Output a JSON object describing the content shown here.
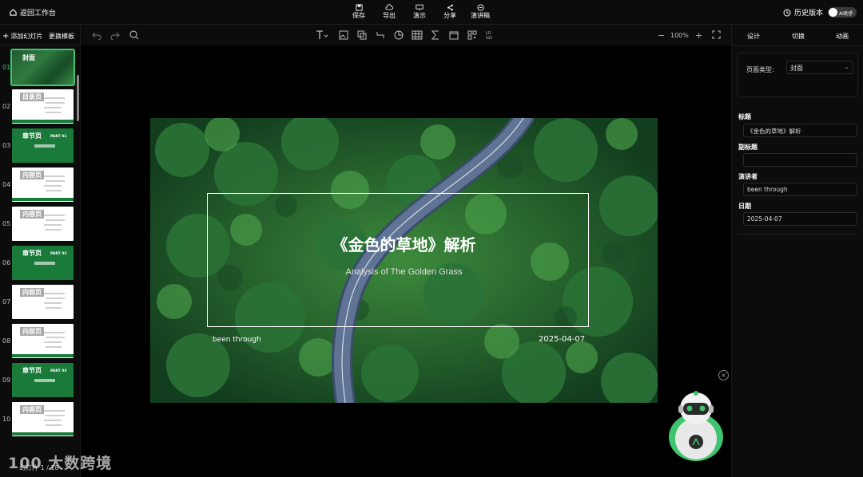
{
  "topbar": {
    "back_label": "返回工作台",
    "buttons": [
      {
        "label": "保存",
        "icon": "save-icon"
      },
      {
        "label": "导出",
        "icon": "cloud-upload-icon"
      },
      {
        "label": "演示",
        "icon": "present-icon"
      },
      {
        "label": "分享",
        "icon": "share-icon"
      },
      {
        "label": "演讲稿",
        "icon": "script-icon"
      }
    ],
    "history_label": "历史版本",
    "ai_toggle_label": "AI助手"
  },
  "sidebar": {
    "add_slide_label": "添加幻灯片",
    "change_template_label": "更换模板",
    "thumbnails": [
      {
        "num": "01",
        "tag": "封面",
        "style": "forest"
      },
      {
        "num": "02",
        "tag": "目录页",
        "style": "toc"
      },
      {
        "num": "03",
        "tag": "章节页",
        "style": "green",
        "part": "PART 01"
      },
      {
        "num": "04",
        "tag": "内容页",
        "style": "white"
      },
      {
        "num": "05",
        "tag": "内容页",
        "style": "white"
      },
      {
        "num": "06",
        "tag": "章节页",
        "style": "green",
        "part": "PART 02"
      },
      {
        "num": "07",
        "tag": "内容页",
        "style": "white"
      },
      {
        "num": "08",
        "tag": "内容页",
        "style": "white"
      },
      {
        "num": "09",
        "tag": "章节页",
        "style": "green",
        "part": "PART 03"
      },
      {
        "num": "10",
        "tag": "内容页",
        "style": "white"
      }
    ],
    "footer": "幻灯片 1 / 18"
  },
  "toolbar": {
    "zoom": "100%"
  },
  "slide": {
    "title": "《金色的草地》解析",
    "subtitle": "Analysis of The Golden Grass",
    "speaker": "been through",
    "date": "2025-04-07"
  },
  "right_panel": {
    "tabs": [
      "设计",
      "切换",
      "动画"
    ],
    "page_type_label": "页面类型:",
    "page_type_value": "封面",
    "fields": [
      {
        "label": "标题",
        "value": "《金色的草地》解析"
      },
      {
        "label": "副标题",
        "value": ""
      },
      {
        "label": "演讲者",
        "value": "been through"
      },
      {
        "label": "日期",
        "value": "2025-04-07"
      }
    ]
  },
  "watermark": "100 大数跨境",
  "colors": {
    "accent": "#3fc46f",
    "brand_green": "#1a7a3a"
  }
}
